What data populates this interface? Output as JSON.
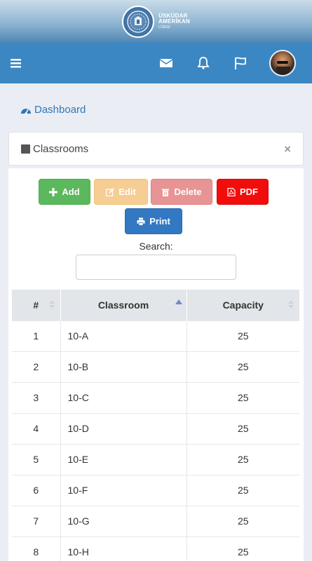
{
  "brand": {
    "line1": "ÜSKÜDAR",
    "line2": "AMERİKAN",
    "line3": "LİSESİ"
  },
  "navbar": {
    "menu_icon": "hamburger-icon",
    "icons": [
      "envelope-icon",
      "bell-icon",
      "flag-icon"
    ],
    "avatar": "user-avatar"
  },
  "breadcrumb": {
    "label": "Dashboard",
    "icon": "dashboard-gauge-icon"
  },
  "panel": {
    "title": "Classrooms",
    "close": "×"
  },
  "toolbar": {
    "add_label": "Add",
    "edit_label": "Edit",
    "delete_label": "Delete",
    "pdf_label": "PDF",
    "print_label": "Print"
  },
  "search": {
    "label": "Search:",
    "value": ""
  },
  "table": {
    "headers": [
      "#",
      "Classroom",
      "Capacity"
    ],
    "rows": [
      {
        "num": "1",
        "room": "10-A",
        "cap": "25"
      },
      {
        "num": "2",
        "room": "10-B",
        "cap": "25"
      },
      {
        "num": "3",
        "room": "10-C",
        "cap": "25"
      },
      {
        "num": "4",
        "room": "10-D",
        "cap": "25"
      },
      {
        "num": "5",
        "room": "10-E",
        "cap": "25"
      },
      {
        "num": "6",
        "room": "10-F",
        "cap": "25"
      },
      {
        "num": "7",
        "room": "10-G",
        "cap": "25"
      },
      {
        "num": "8",
        "room": "10-H",
        "cap": "25"
      }
    ]
  },
  "colors": {
    "navbar": "#3b87c3",
    "add": "#5cb85c",
    "edit": "#f6cd93",
    "delete": "#e89494",
    "pdf": "#f20c0c",
    "print": "#3278c2"
  }
}
